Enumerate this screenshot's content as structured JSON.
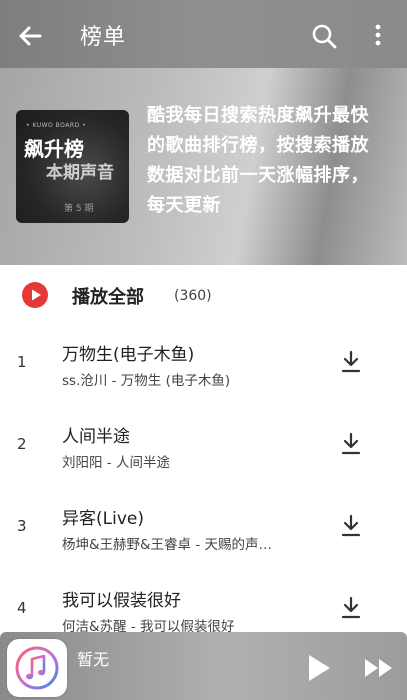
{
  "header": {
    "title": "榜单",
    "icons": {
      "back": "back-arrow-icon",
      "search": "search-icon",
      "more": "more-vert-icon"
    }
  },
  "playlist": {
    "cover": {
      "brand": "• KUWO BOARD •",
      "name": "飙升榜",
      "sub": "本期声音",
      "issue": "第 5 期"
    },
    "description": "酷我每日搜索热度飙升最快的歌曲排行榜，按搜索播放数据对比前一天涨幅排序，每天更新"
  },
  "playall": {
    "label": "播放全部",
    "count": "(360)",
    "accent": "#e53935"
  },
  "songs": [
    {
      "index": "1",
      "title": "万物生(电子木鱼)",
      "subtitle": "ss.沧川 - 万物生 (电子木鱼)"
    },
    {
      "index": "2",
      "title": "人间半途",
      "subtitle": "刘阳阳 - 人间半途"
    },
    {
      "index": "3",
      "title": "异客(Live)",
      "subtitle": "杨坤&王赫野&王睿卓 - 天赐的声…"
    },
    {
      "index": "4",
      "title": "我可以假装很好",
      "subtitle": "何洁&苏醒 - 我可以假装很好"
    }
  ],
  "player": {
    "now_playing": "暂无"
  }
}
